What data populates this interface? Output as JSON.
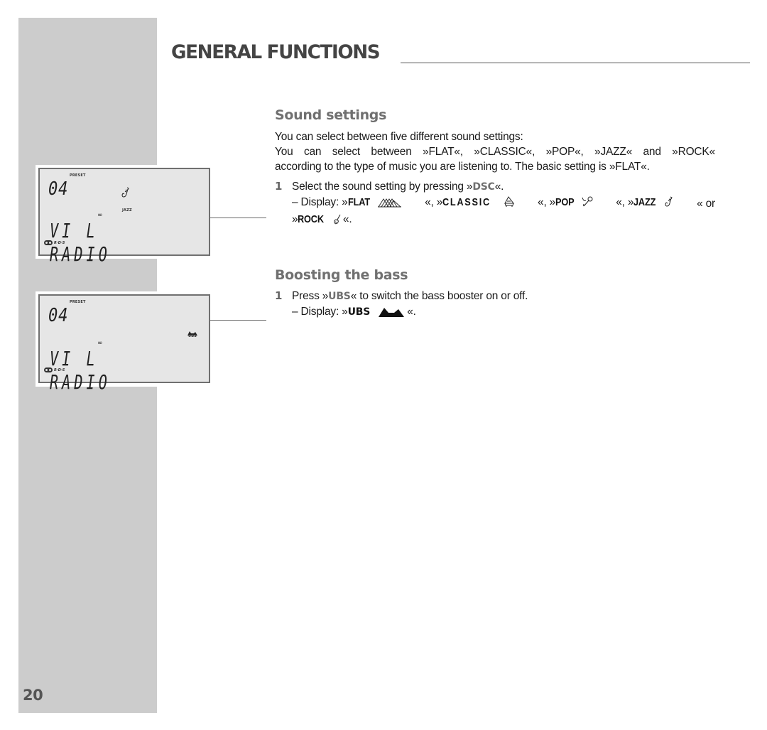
{
  "page": {
    "number": "20",
    "section_title": "GENERAL FUNCTIONS"
  },
  "sound_settings": {
    "heading": "Sound settings",
    "intro_line1": "You can select between five different sound settings:",
    "intro_line2": "You can select between »FLAT«, »CLASSIC«, »POP«, »JAZZ« and »ROCK«",
    "intro_line3": "according to the type of music you are listening to. The basic setting is »FLAT«.",
    "step_number": "1",
    "step_text_prefix": "Select the sound setting by pressing »",
    "step_key": "DSC",
    "step_text_suffix": "«.",
    "display_prefix": "– Display: »",
    "modes": [
      {
        "label": "FLAT",
        "icon": "flat-wave-icon"
      },
      {
        "label": "CLASSIC",
        "icon": "piano-icon"
      },
      {
        "label": "POP",
        "icon": "microphone-icon"
      },
      {
        "label": "JAZZ",
        "icon": "saxophone-icon"
      },
      {
        "label": "ROCK",
        "icon": "guitar-icon"
      }
    ],
    "sep": "«, »",
    "or_text": "« or",
    "rock_prefix": "»",
    "end_text": "«."
  },
  "bass": {
    "heading": "Boosting the bass",
    "step_number": "1",
    "step_text_prefix": "Press »",
    "step_key": "UBS",
    "step_text_suffix": "« to switch the bass booster on or off.",
    "display_prefix": "– Display: »",
    "display_word": "UBS",
    "display_icon": "bass-boost-icon",
    "display_suffix": "«."
  },
  "lcd_panels": [
    {
      "preset_label": "PRESET",
      "preset_value": "04",
      "mode_label": "JAZZ",
      "mode_icon": "saxophone-icon",
      "stereo_symbol": "∞",
      "station_text": "VI L RADIO",
      "rds_label": "R·D·S"
    },
    {
      "preset_label": "PRESET",
      "preset_value": "04",
      "mode_label": "UBS",
      "mode_icon": "bass-boost-icon",
      "stereo_symbol": "∞",
      "station_text": "VI L RADIO",
      "rds_label": "R·D·S"
    }
  ]
}
